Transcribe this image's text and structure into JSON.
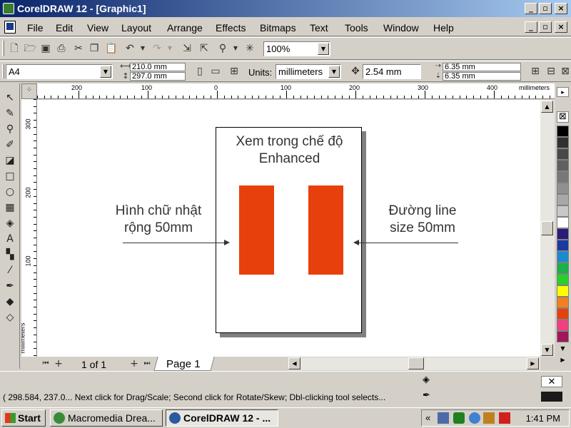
{
  "window": {
    "title": "CorelDRAW 12 - [Graphic1]"
  },
  "menu": {
    "items": [
      {
        "label": "File"
      },
      {
        "label": "Edit"
      },
      {
        "label": "View"
      },
      {
        "label": "Layout"
      },
      {
        "label": "Arrange"
      },
      {
        "label": "Effects"
      },
      {
        "label": "Bitmaps"
      },
      {
        "label": "Text"
      },
      {
        "label": "Tools"
      },
      {
        "label": "Window"
      },
      {
        "label": "Help"
      }
    ]
  },
  "toolbar": {
    "zoom": "100%"
  },
  "property_bar": {
    "paper_size": "A4",
    "width": "210.0 mm",
    "height": "297.0 mm",
    "units_label": "Units:",
    "units": "millimeters",
    "nudge": "2.54 mm",
    "dup_x": "6.35 mm",
    "dup_y": "6.35 mm"
  },
  "rulers": {
    "top_unit": "millimeters",
    "left_unit": "millimeters",
    "top_labels": [
      "200",
      "100",
      "0",
      "100",
      "200",
      "300",
      "400"
    ],
    "left_labels": [
      "300",
      "200",
      "100"
    ]
  },
  "canvas": {
    "page_title_line1": "Xem trong chế độ",
    "page_title_line2": "Enhanced",
    "left_label_line1": "Hình chữ nhật",
    "left_label_line2": "rộng 50mm",
    "right_label_line1": "Đường line",
    "right_label_line2": "size 50mm",
    "rect_color": "#e8400c"
  },
  "page_nav": {
    "counter": "1 of 1",
    "tab": "Page 1"
  },
  "status": {
    "text": "( 298.584, 237.0...   Next click for Drag/Scale; Second click for Rotate/Skew; Dbl-clicking tool selects..."
  },
  "palette": {
    "colors": [
      "#000000",
      "#303030",
      "#484848",
      "#606060",
      "#787878",
      "#909090",
      "#a8a8a8",
      "#c8c8c8",
      "#ffffff",
      "#2a1a7a",
      "#1a3aa0",
      "#1a8ad0",
      "#1ab04a",
      "#2ad02a",
      "#ffff00",
      "#f08020",
      "#e8400c",
      "#f04080",
      "#a0185a"
    ]
  },
  "taskbar": {
    "start": "Start",
    "tasks": [
      {
        "label": "Macromedia Drea..."
      },
      {
        "label": "CorelDRAW 12 - ..."
      }
    ],
    "tray_chevron": "«",
    "clock": "1:41 PM"
  }
}
